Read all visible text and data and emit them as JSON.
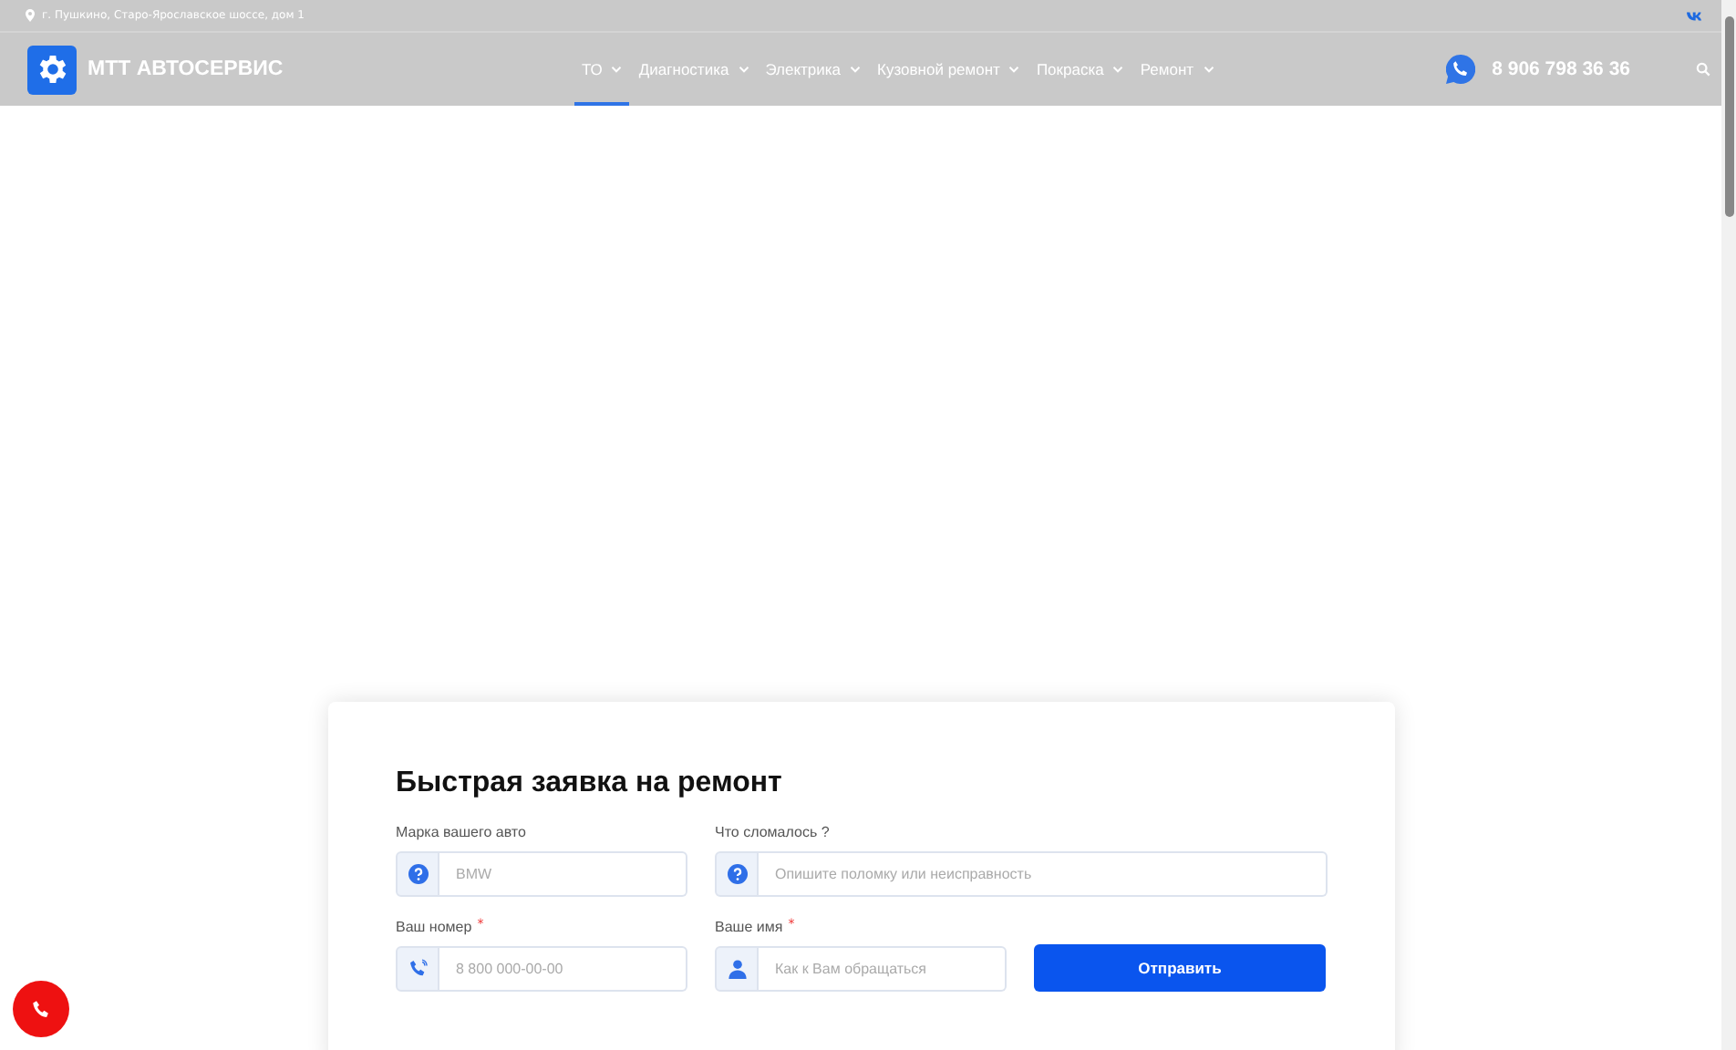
{
  "top_bar": {
    "address": "г. Пушкино, Старо-Ярославское шоссе, дом 1"
  },
  "header": {
    "logo_text": "МТТ АВТОСЕРВИС",
    "nav": [
      {
        "label": "ТО",
        "selected": true
      },
      {
        "label": "Диагностика",
        "selected": false
      },
      {
        "label": "Электрика",
        "selected": false
      },
      {
        "label": "Кузовной ремонт",
        "selected": false
      },
      {
        "label": "Покраска",
        "selected": false
      },
      {
        "label": "Ремонт",
        "selected": false
      }
    ],
    "phone": "8 906 798 36 36"
  },
  "form": {
    "title": "Быстрая заявка на ремонт",
    "rows": [
      [
        {
          "label": "Марка вашего авто",
          "kind": "question",
          "placeholder": "BMW"
        },
        {
          "label": "Что сломалось ?",
          "kind": "question",
          "placeholder": "Опишите поломку или неисправность"
        }
      ],
      [
        {
          "label": "Ваш номер",
          "required_mark": "*",
          "kind": "phone",
          "placeholder": "8 800 000-00-00"
        },
        {
          "label": "Ваше имя",
          "required_mark": "*",
          "kind": "person",
          "placeholder": "Как к Вам обращаться"
        }
      ]
    ],
    "submit": "Отправить"
  }
}
